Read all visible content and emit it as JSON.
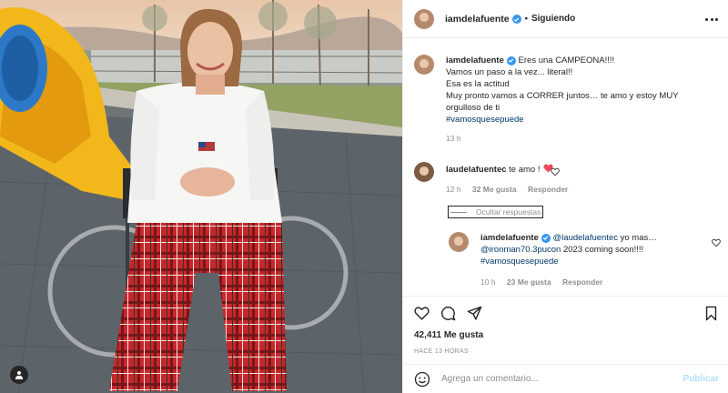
{
  "post": {
    "author": "iamdelafuente",
    "follow_label": "Siguiendo",
    "separator": "•"
  },
  "caption": {
    "username": "iamdelafuente",
    "line1": "Eres una CAMPEONA!!!!",
    "line2": "Vamos un paso a la vez... literal!!",
    "line3": "Esa es la actitud",
    "line4": "Muy pronto vamos a CORRER juntos… te amo y estoy MUY",
    "line5": "orgulloso de ti",
    "hashtag": "#vamosquesepuede",
    "time": "13 h"
  },
  "comment": {
    "username": "laudelafuentec",
    "text": "te amo !",
    "time": "12 h",
    "likes": "32 Me gusta",
    "reply_label": "Responder"
  },
  "hide_replies_label": "Ocultar respuestas",
  "reply": {
    "username": "iamdelafuente",
    "mention": "@laudelafuentec",
    "text1": " yo mas…",
    "mention2": "@ironman70.3pucon",
    "text2": " 2023 coming soon!!!!",
    "hashtag": "#vamosquesepuede",
    "time": "10 h",
    "likes": "23 Me gusta",
    "reply_label": "Responder"
  },
  "stats": {
    "likes": "42,411 Me gusta",
    "time_ago": "HACE 13 HORAS"
  },
  "composer": {
    "placeholder": "Agrega un comentario...",
    "publish_label": "Publicar"
  },
  "icons": {
    "verified": "verified-badge-icon",
    "more": "more-options-icon",
    "like": "heart-icon",
    "comment": "comment-icon",
    "share": "share-icon",
    "save": "bookmark-icon",
    "emoji": "emoji-icon",
    "tag": "user-tag-icon"
  },
  "colors": {
    "verified": "#3897f0",
    "link": "#00376b",
    "heart_red": "#ed4956",
    "publish_disabled": "#b2dffc",
    "muted": "#8e8e8e"
  }
}
